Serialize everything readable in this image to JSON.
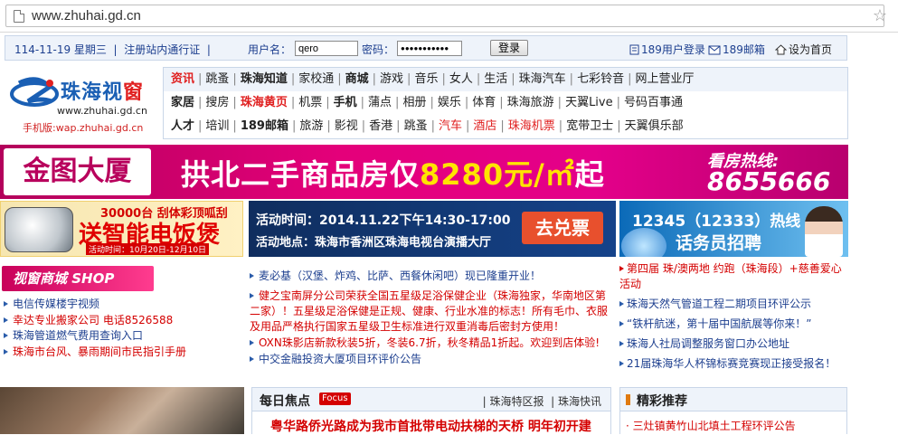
{
  "browser": {
    "url": "www.zhuhai.gd.cn"
  },
  "infobar": {
    "date": "114-11-19 星期三",
    "register": "注册站内通行证",
    "sep": "|",
    "user_label": "用户名：",
    "user_value": "qero",
    "pass_label": "密码：",
    "pass_value": "●●●●●●●●●●●",
    "login": "登录",
    "svc1": "189用户登录",
    "svc2": "189邮箱",
    "svc3": "设为首页"
  },
  "logo": {
    "name_blue": "珠海视",
    "name_red": "窗",
    "url": "www.zhuhai.gd.cn",
    "wap": "手机版:wap.zhuhai.gd.cn"
  },
  "nav": {
    "row0": [
      {
        "t": "资讯",
        "s": "red b"
      },
      {
        "t": "跳蚤"
      },
      {
        "t": "珠海知道",
        "s": "b"
      },
      {
        "t": "家校通"
      },
      {
        "t": "商城",
        "s": "b"
      },
      {
        "t": "游戏"
      },
      {
        "t": "音乐"
      },
      {
        "t": "女人"
      },
      {
        "t": "生活"
      },
      {
        "t": "珠海汽车"
      },
      {
        "t": "七彩铃音"
      },
      {
        "t": "网上营业厅"
      }
    ],
    "row1": [
      {
        "t": "家居",
        "s": "b"
      },
      {
        "t": "搜房"
      },
      {
        "t": "珠海黄页",
        "s": "red b"
      },
      {
        "t": "机票"
      },
      {
        "t": "手机",
        "s": "b"
      },
      {
        "t": "蒲点"
      },
      {
        "t": "相册"
      },
      {
        "t": "娱乐"
      },
      {
        "t": "体育"
      },
      {
        "t": "珠海旅游"
      },
      {
        "t": "天翼Live"
      },
      {
        "t": "号码百事通"
      }
    ],
    "row2": [
      {
        "t": "人才",
        "s": "b"
      },
      {
        "t": "培训"
      },
      {
        "t": "189邮箱",
        "s": "b"
      },
      {
        "t": "旅游"
      },
      {
        "t": "影视"
      },
      {
        "t": "香港"
      },
      {
        "t": "跳蚤"
      },
      {
        "t": "汽车",
        "s": "red"
      },
      {
        "t": "酒店",
        "s": "red"
      },
      {
        "t": "珠海机票",
        "s": "red"
      },
      {
        "t": "宽带卫士"
      },
      {
        "t": "天翼俱乐部"
      }
    ]
  },
  "banner1": {
    "box": "金图大厦",
    "main_a": "拱北二手商品房仅",
    "main_b": "8280元/㎡",
    "main_c": "起",
    "hot": "看房热线:",
    "num": "8655666"
  },
  "banner2": {
    "top": "30000台 刮体彩顶呱刮",
    "big": "送智能电饭煲",
    "date": "活动时间：10月20日-12月10日"
  },
  "banner3": {
    "l1": "活动时间：2014.11.22下午14:30-17:00",
    "l2": "活动地点：珠海市香洲区珠海电视台演播大厅",
    "btn": "去兑票"
  },
  "banner4": {
    "a": "12345（12333）热线",
    "b": "话务员招聘"
  },
  "mall": {
    "label": "视窗商城 SHOP"
  },
  "leftlinks": [
    {
      "t": "电信传媒楼宇视频",
      "c": "blue"
    },
    {
      "t": "幸达专业搬家公司 电话8526588",
      "c": "red"
    },
    {
      "t": "珠海管道燃气费用查询入口",
      "c": "blue"
    },
    {
      "t": "珠海市台风、暴雨期间市民指引手册",
      "c": "red"
    }
  ],
  "centerlist": [
    {
      "t": "麦必基（汉堡、炸鸡、比萨、西餐休闲吧）现已隆重开业！",
      "c": "blue"
    },
    {
      "t": "健之宝南屏分公司荣获全国五星级足浴保健企业（珠海独家，华南地区第二家）！五星级足浴保健是正规、健康、行业水准的标志！所有毛巾、衣服及用品严格执行国家五星级卫生标准进行双重消毒后密封方使用！",
      "c": "red"
    },
    {
      "t": "OXN珠影店新款秋装5折，冬装6.7折，秋冬精品1折起。欢迎到店体验!",
      "c": "red"
    },
    {
      "t": "中交金融投资大厦项目环评价公告",
      "c": "blue"
    }
  ],
  "rightlist": [
    {
      "t": "第四届 珠/澳两地 约跑（珠海段）+慈善爱心活动",
      "c": "red"
    },
    {
      "t": "珠海天然气管道工程二期项目环评公示",
      "c": "blue"
    },
    {
      "t": "“铁杆航迷，第十届中国航展等你来！”",
      "c": "blue"
    },
    {
      "t": "珠海人社局调整服务窗口办公地址",
      "c": "blue"
    },
    {
      "t": "21届珠海华人杯锦标赛竞赛现正接受报名！",
      "c": "blue"
    }
  ],
  "focus": {
    "title": "每日焦点",
    "badge": "Focus",
    "tab1": "珠海特区报",
    "tab2": "珠海快讯",
    "headline": "粤华路侨光路成为我市首批带电动扶梯的天桥 明年初开建"
  },
  "recommend": {
    "title": "精彩推荐",
    "item": "三灶镇黄竹山北填土工程环评公告"
  }
}
